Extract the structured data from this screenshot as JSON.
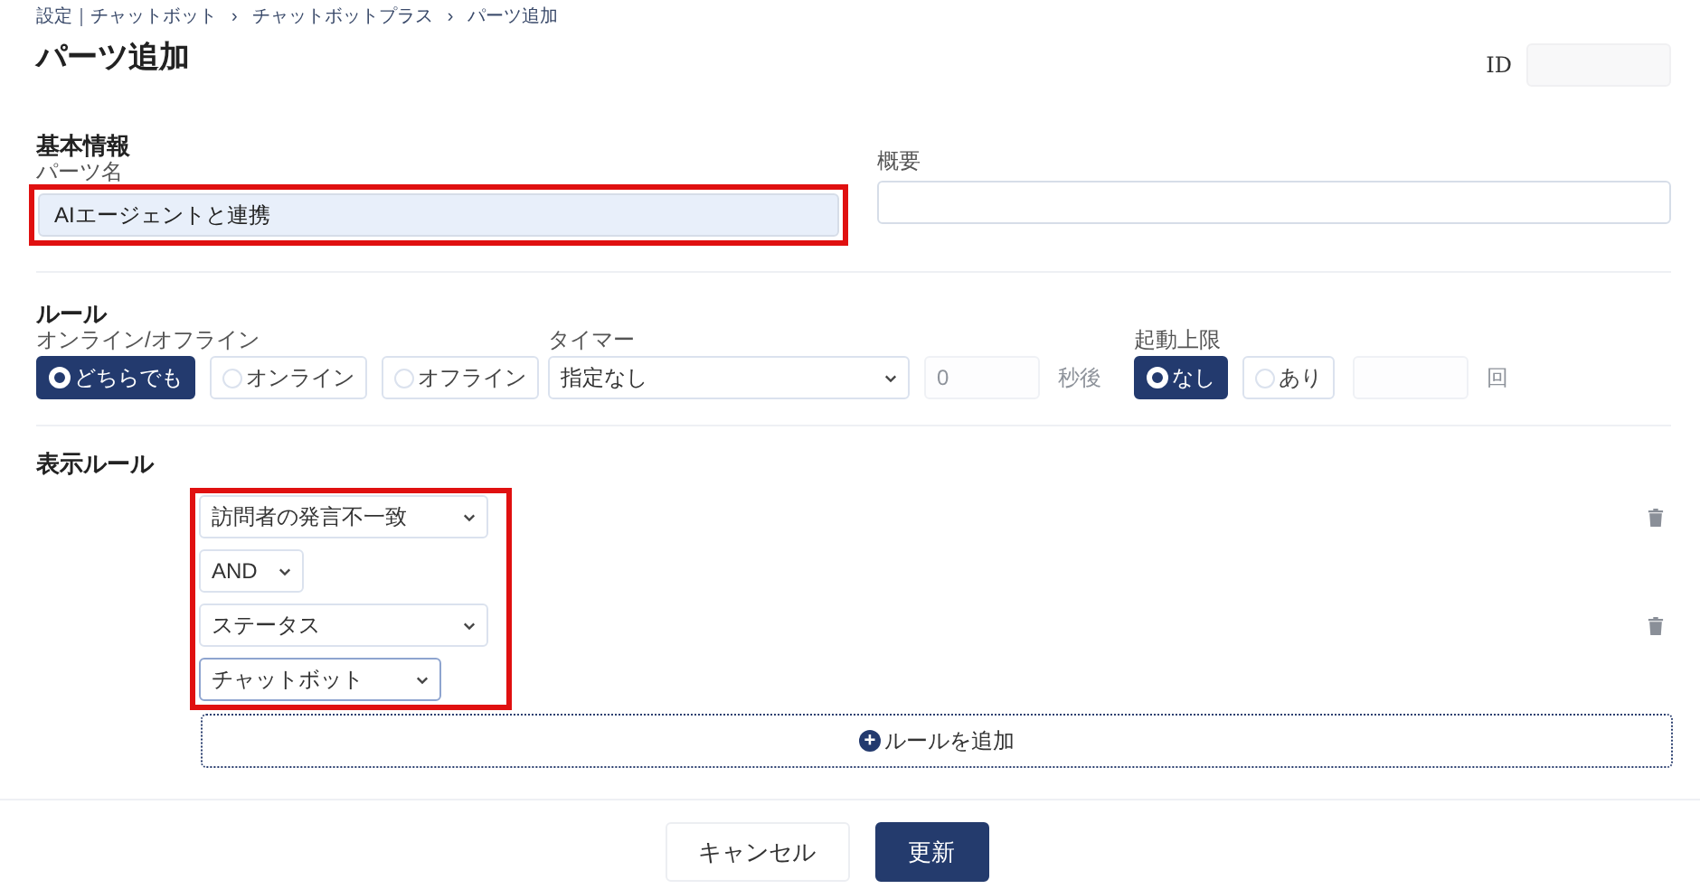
{
  "breadcrumb": [
    "設定｜チャットボット",
    "チャットボットプラス",
    "パーツ追加"
  ],
  "breadcrumb_separator": "›",
  "title": "パーツ追加",
  "id_field": {
    "label": "ID"
  },
  "basic_info": {
    "heading": "基本情報",
    "name": {
      "label": "パーツ名",
      "value": "AIエージェントと連携",
      "highlighted": true
    },
    "summary": {
      "label": "概要"
    }
  },
  "rules": {
    "heading": "ルール",
    "online": {
      "label": "オンライン/オフライン",
      "options": [
        {
          "label": "どちらでも",
          "selected": true
        },
        {
          "label": "オンライン",
          "selected": false
        },
        {
          "label": "オフライン",
          "selected": false
        }
      ]
    },
    "timer": {
      "label": "タイマー",
      "value": "指定なし",
      "seconds": {
        "placeholder": "0",
        "unit": "秒後",
        "disabled": true
      }
    },
    "limit": {
      "label": "起動上限",
      "options": [
        {
          "label": "なし",
          "selected": true
        },
        {
          "label": "あり",
          "selected": false
        }
      ],
      "count": {
        "unit": "回",
        "disabled": true
      }
    }
  },
  "display_rules": {
    "heading": "表示ルール",
    "highlighted": true,
    "items": [
      {
        "kind": "condition",
        "value": "訪問者の発言不一致"
      },
      {
        "kind": "operator",
        "value": "AND"
      },
      {
        "kind": "condition",
        "value": "ステータス"
      },
      {
        "kind": "sub",
        "value": "チャットボット"
      }
    ],
    "add_button": {
      "icon": "+",
      "label": "ルールを追加"
    }
  },
  "buttons": [
    {
      "label": "キャンセル",
      "kind": "secondary"
    },
    {
      "label": "更新",
      "kind": "primary"
    }
  ]
}
